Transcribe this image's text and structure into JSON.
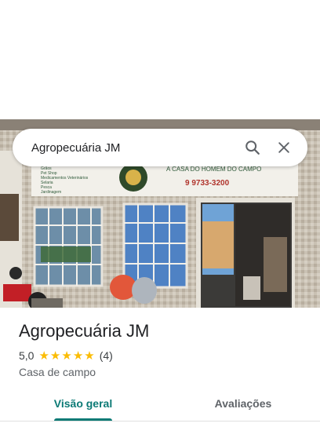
{
  "search": {
    "query": "Agropecuária JM"
  },
  "photo": {
    "sign_tagline": "A CASA DO HOMEM DO CAMPO",
    "sign_phone": "9 9733-3200",
    "sign_list": [
      "Grãos",
      "Pet Shop",
      "Medicamentos Veterinários",
      "Selaria",
      "Pesca",
      "Jardinagem"
    ]
  },
  "place": {
    "name": "Agropecuária JM",
    "rating": "5,0",
    "stars": 5,
    "review_count": "(4)",
    "category": "Casa de campo"
  },
  "tabs": [
    {
      "label": "Visão geral",
      "active": true
    },
    {
      "label": "Avaliações",
      "active": false
    }
  ],
  "colors": {
    "accent": "#0b7a75",
    "star": "#fbbc04"
  }
}
